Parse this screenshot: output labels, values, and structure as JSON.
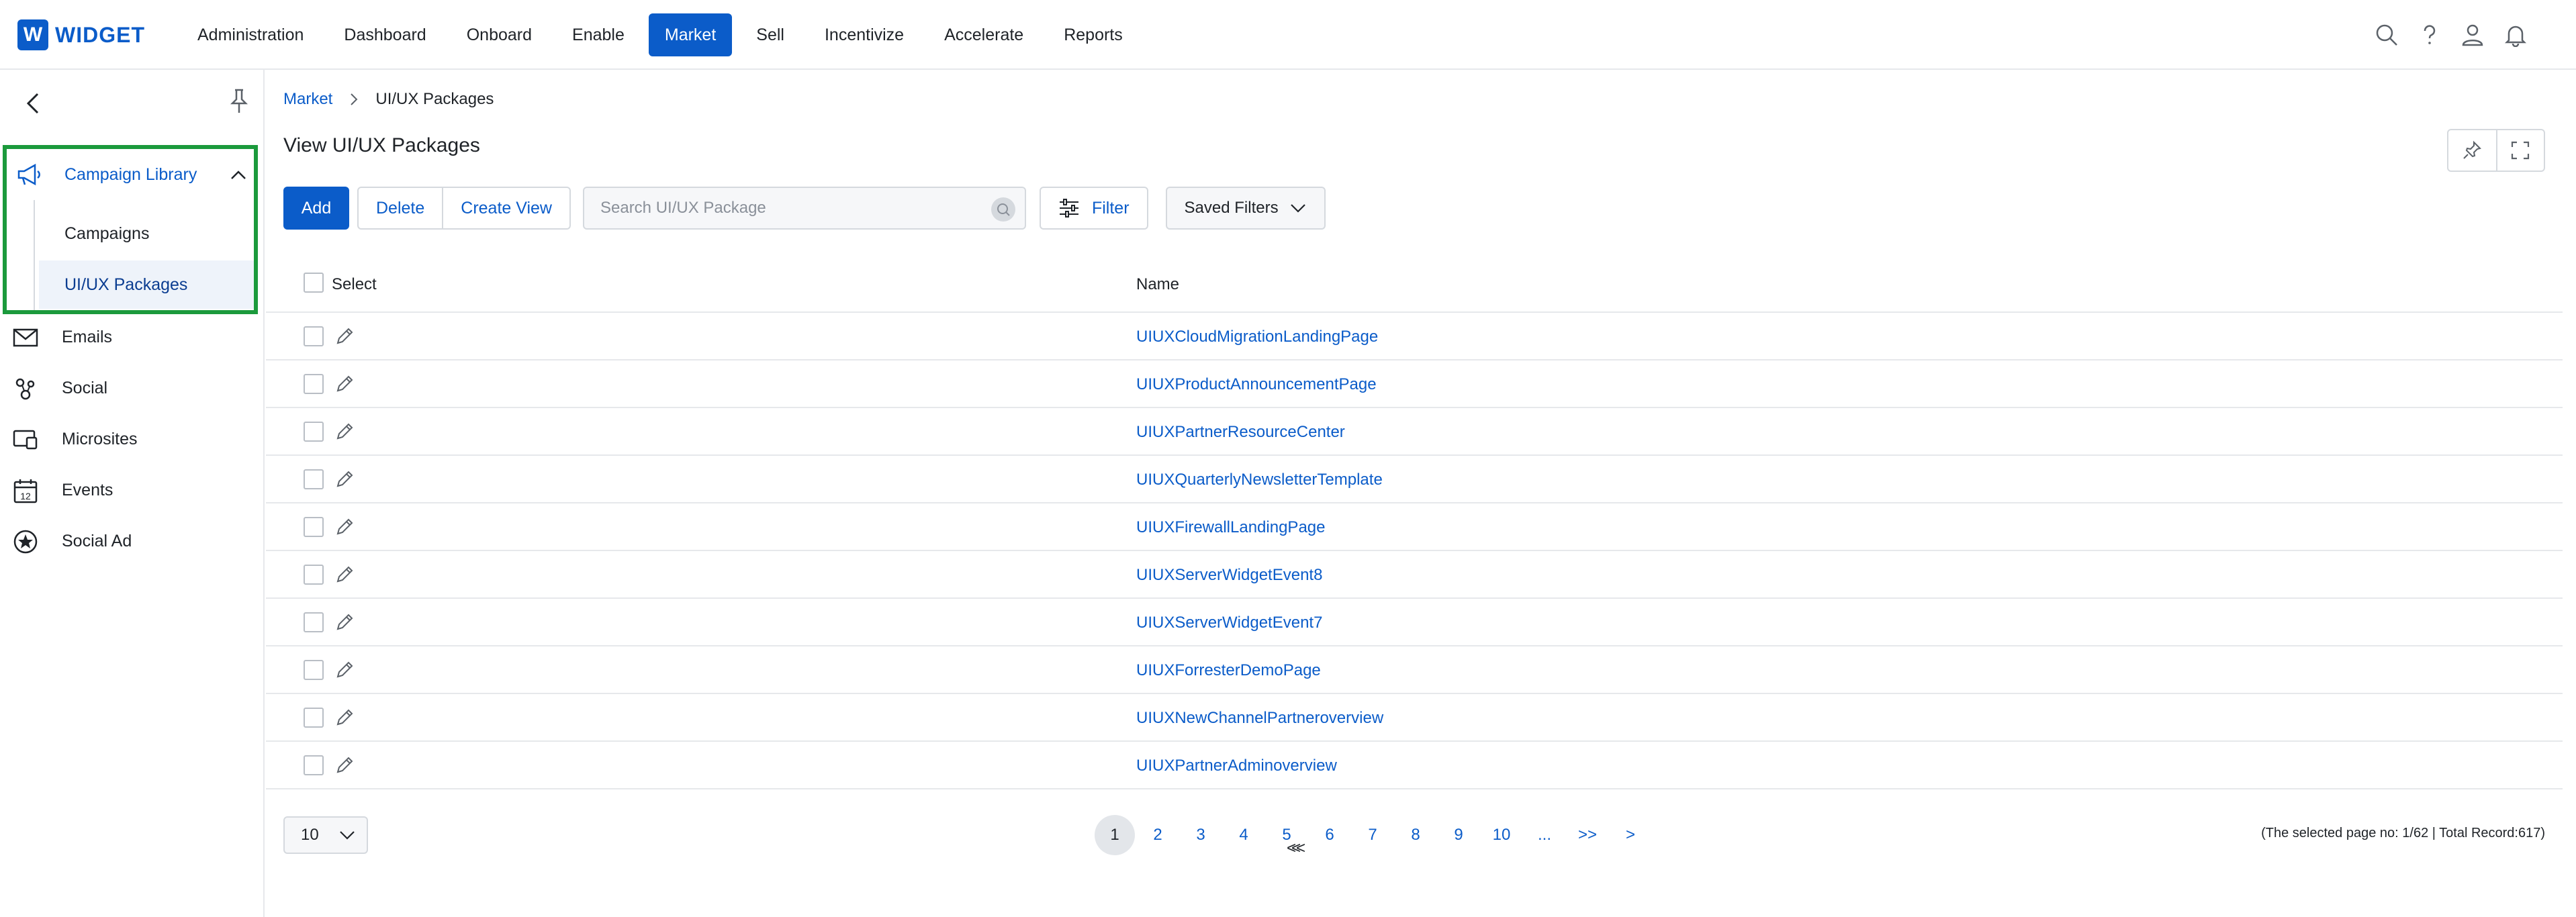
{
  "logo": {
    "mark": "W",
    "text": "WIDGET"
  },
  "nav": {
    "items": [
      "Administration",
      "Dashboard",
      "Onboard",
      "Enable",
      "Market",
      "Sell",
      "Incentivize",
      "Accelerate",
      "Reports"
    ],
    "active": "Market"
  },
  "top_icons": [
    "search-icon",
    "help-icon",
    "user-icon",
    "bell-icon"
  ],
  "sidebar": {
    "group": {
      "label": "Campaign Library",
      "icon": "megaphone-icon",
      "children": [
        "Campaigns",
        "UI/UX Packages"
      ],
      "active_child": "UI/UX Packages"
    },
    "items": [
      {
        "label": "Emails",
        "icon": "mail-icon"
      },
      {
        "label": "Social",
        "icon": "social-icon"
      },
      {
        "label": "Microsites",
        "icon": "microsite-icon"
      },
      {
        "label": "Events",
        "icon": "calendar-icon"
      },
      {
        "label": "Social Ad",
        "icon": "star-badge-icon"
      }
    ]
  },
  "breadcrumb": {
    "parent": "Market",
    "current": "UI/UX Packages"
  },
  "page": {
    "title": "View UI/UX Packages"
  },
  "toolbar": {
    "add": "Add",
    "delete": "Delete",
    "create_view": "Create View",
    "search_placeholder": "Search UI/UX Package",
    "filter": "Filter",
    "saved_filters": "Saved Filters"
  },
  "table": {
    "columns": {
      "select": "Select",
      "name": "Name"
    },
    "rows": [
      "UIUXCloudMigrationLandingPage",
      "UIUXProductAnnouncementPage",
      "UIUXPartnerResourceCenter",
      "UIUXQuarterlyNewsletterTemplate",
      "UIUXFirewallLandingPage",
      "UIUXServerWidgetEvent8",
      "UIUXServerWidgetEvent7",
      "UIUXForresterDemoPage",
      "UIUXNewChannelPartneroverview",
      "UIUXPartnerAdminoverview"
    ]
  },
  "pagination": {
    "per_page": "10",
    "prev": "<",
    "first": "<<",
    "pages": [
      "1",
      "2",
      "3",
      "4",
      "5",
      "6",
      "7",
      "8",
      "9",
      "10"
    ],
    "ellipsis": "...",
    "last": ">>",
    "next": ">",
    "current": "1",
    "info": "(The selected page no: 1/62 | Total Record:617)"
  },
  "colors": {
    "brand": "#0b5cc9",
    "highlight_border": "#1b9a3c"
  }
}
